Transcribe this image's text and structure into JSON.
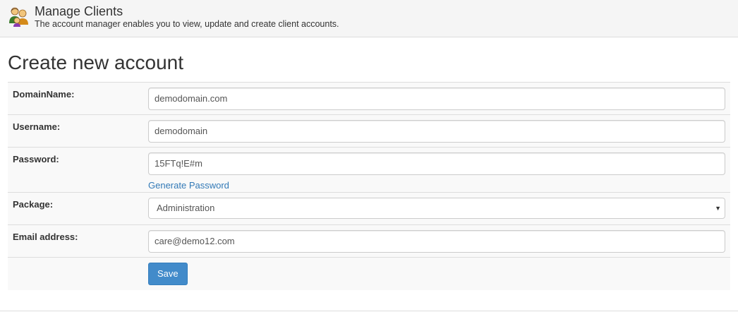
{
  "header": {
    "title": "Manage Clients",
    "description": "The account manager enables you to view, update and create client accounts.",
    "icon": "users-icon"
  },
  "page": {
    "title": "Create new account"
  },
  "form": {
    "domain_label": "DomainName:",
    "domain_value": "demodomain.com",
    "username_label": "Username:",
    "username_value": "demodomain",
    "password_label": "Password:",
    "password_value": "15FTq!E#m",
    "generate_password_link": "Generate Password",
    "package_label": "Package:",
    "package_selected": "Administration",
    "email_label": "Email address:",
    "email_value": "care@demo12.com",
    "save_label": "Save"
  },
  "colors": {
    "accent": "#428bca",
    "link": "#337ab7",
    "row_bg": "#f9f9f9",
    "header_bg": "#f5f5f5"
  }
}
